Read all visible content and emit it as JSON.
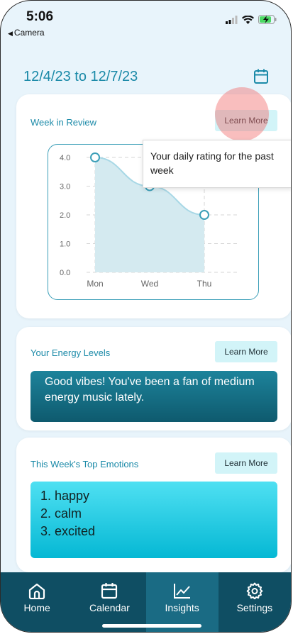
{
  "status_bar": {
    "time": "5:06",
    "back_label": "Camera"
  },
  "header": {
    "date_range": "12/4/23 to 12/7/23"
  },
  "week_review": {
    "title": "Week in Review",
    "learn_more": "Learn More",
    "tooltip": "Your daily rating for the past week"
  },
  "chart_data": {
    "type": "area",
    "categories": [
      "Mon",
      "Wed",
      "Thu"
    ],
    "values": [
      4.0,
      3.0,
      2.0
    ],
    "y_ticks": [
      "4.0",
      "3.0",
      "2.0",
      "1.0",
      "0.0"
    ],
    "ylim": [
      0,
      4
    ],
    "grid": true,
    "line_color": "#3c9fb8",
    "fill_color": "#d4eaf0"
  },
  "energy": {
    "title": "Your Energy Levels",
    "learn_more": "Learn More",
    "message": "Good vibes! You've been a fan of medium energy music lately."
  },
  "emotions": {
    "title": "This Week's Top Emotions",
    "learn_more": "Learn More",
    "items": [
      "1. happy",
      "2. calm",
      "3. excited"
    ]
  },
  "tabs": [
    {
      "label": "Home",
      "icon": "home-icon"
    },
    {
      "label": "Calendar",
      "icon": "calendar-icon"
    },
    {
      "label": "Insights",
      "icon": "chart-icon",
      "active": true
    },
    {
      "label": "Settings",
      "icon": "gear-icon"
    }
  ],
  "colors": {
    "accent": "#1b8aa8",
    "tabbar": "#0f4e63",
    "tab_active": "#1a6b84"
  }
}
